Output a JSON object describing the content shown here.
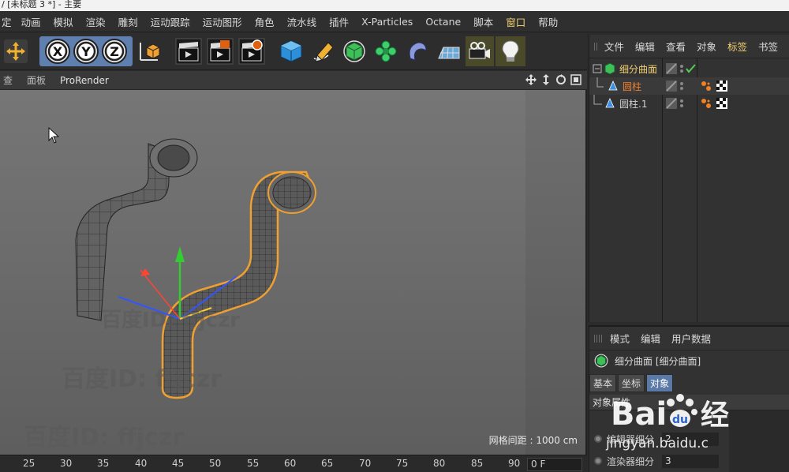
{
  "window": {
    "title_fragment": "/  [未标题 3 *]  - 主要"
  },
  "menu_bar": {
    "first_fragment": "定",
    "items": [
      "动画",
      "模拟",
      "渲染",
      "雕刻",
      "运动跟踪",
      "运动图形",
      "角色",
      "流水线",
      "插件",
      "X-Particles",
      "Octane",
      "脚本",
      "窗口",
      "帮助"
    ]
  },
  "viewport_header": {
    "items": [
      "查",
      "面板",
      "ProRender"
    ]
  },
  "viewport": {
    "grid_spacing": "网格间距 : 1000 cm",
    "watermarks": [
      "百度ID: ffjczr",
      "百度ID: ffjczr",
      "百度ID: ffjczr"
    ]
  },
  "timeline": {
    "ticks": [
      "25",
      "30",
      "35",
      "40",
      "45",
      "50",
      "55",
      "60",
      "65",
      "70",
      "75",
      "80",
      "85",
      "90"
    ],
    "frame": "0 F"
  },
  "object_manager": {
    "menu": [
      "文件",
      "编辑",
      "查看",
      "对象",
      "标签",
      "书签"
    ],
    "objects": [
      {
        "name": "细分曲面",
        "selected_color": "#f0d070"
      },
      {
        "name": "圆柱",
        "selected_color": "#f08030"
      },
      {
        "name": "圆柱.1",
        "selected_color": "#cfcfcf"
      }
    ]
  },
  "attribute_manager": {
    "menu": [
      "模式",
      "编辑",
      "用户数据"
    ],
    "object_title": "细分曲面 [细分曲面]",
    "tabs": [
      "基本",
      "坐标",
      "对象"
    ],
    "active_tab": "对象",
    "section_title": "对象属性",
    "rows": [
      {
        "label": "编辑器细分",
        "value": "2"
      },
      {
        "label": "渲染器细分",
        "value": "3"
      }
    ]
  },
  "overlay": {
    "baidu_url": "jingyan.baidu.c"
  },
  "colors": {
    "accent_selection": "#f0a030",
    "active_tab": "#5a79a6",
    "background": "#2b2b2b"
  }
}
